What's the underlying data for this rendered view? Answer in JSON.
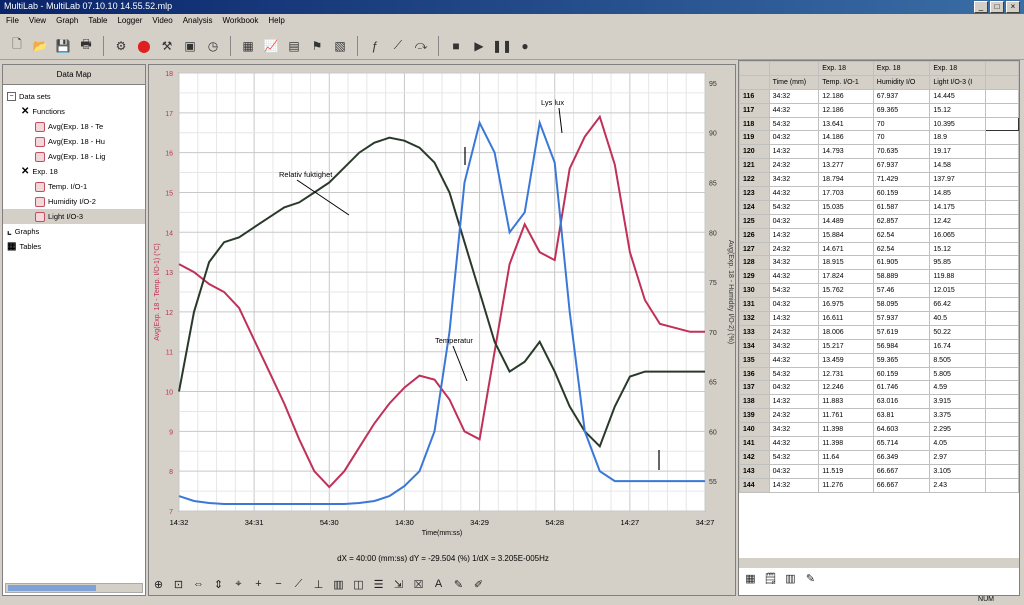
{
  "titlebar": {
    "title": "MultiLab - MultiLab 07.10.10 14.55.52.mlp",
    "buttons": [
      "_",
      "□",
      "×"
    ]
  },
  "menu": [
    "File",
    "View",
    "Graph",
    "Table",
    "Logger",
    "Video",
    "Analysis",
    "Workbook",
    "Help"
  ],
  "toolbar_icons": [
    "new-file-icon",
    "open-folder-icon",
    "save-icon",
    "print-icon",
    "run-icon",
    "stop-icon",
    "setup-icon",
    "logger-icon",
    "timer-icon",
    "graph-icon",
    "chart-icon",
    "table-icon",
    "flag-icon",
    "map-icon",
    "function-icon",
    "fit-icon",
    "curve-icon",
    "stop-square-icon",
    "play-icon",
    "pause-icon",
    "record-icon"
  ],
  "datamap": {
    "header": "Data Map",
    "tree": [
      {
        "label": "Data sets",
        "level": 0,
        "kind": "expander"
      },
      {
        "label": "Functions",
        "level": 1,
        "kind": "x"
      },
      {
        "label": "Avg(Exp. 18 - Te",
        "level": 2,
        "kind": "func"
      },
      {
        "label": "Avg(Exp. 18 - Hu",
        "level": 2,
        "kind": "func"
      },
      {
        "label": "Avg(Exp. 18 - Lig",
        "level": 2,
        "kind": "func"
      },
      {
        "label": "Exp. 18",
        "level": 1,
        "kind": "x"
      },
      {
        "label": "Temp. I/O-1",
        "level": 2,
        "kind": "sensor"
      },
      {
        "label": "Humidity I/O-2",
        "level": 2,
        "kind": "sensor"
      },
      {
        "label": "Light I/O-3",
        "level": 2,
        "kind": "sensor"
      },
      {
        "label": "Graphs",
        "level": 0,
        "kind": "graph"
      },
      {
        "label": "Tables",
        "level": 0,
        "kind": "table"
      }
    ]
  },
  "graph": {
    "status": "dX = 40:00 (mm:ss) dY = -29.504 (%)  1/dX = 3.205E-005Hz",
    "xlabel": "Time(mm:ss)",
    "left_axis_label": "Avg(Exp. 18 - Temp. I/O-1) (°C)",
    "right_axis_label": "Avg(Exp. 18 - Humidity I/O-2) (%)",
    "annotations": {
      "humidity": "Relativ fuktighet",
      "light": "Lys lux",
      "temp": "Temperatur"
    },
    "tools": [
      "zoom-in-icon",
      "zoom-box-icon",
      "zoom-x-icon",
      "zoom-y-icon",
      "cursor-icon",
      "plus-icon",
      "minus-icon",
      "line-chart-icon",
      "axis-icon",
      "bars-icon",
      "graph-type-icon",
      "legend-icon",
      "scale-icon",
      "close-graph-icon",
      "text-icon",
      "marker-icon",
      "pen-icon"
    ]
  },
  "chart_data": {
    "type": "line",
    "x_tick_labels": [
      "14:32",
      "34:31",
      "54:30",
      "14:30",
      "34:29",
      "54:28",
      "14:27",
      "34:27"
    ],
    "x": [
      0,
      10,
      20,
      30,
      40,
      50,
      60,
      70,
      80,
      90,
      100,
      110,
      120,
      130,
      140,
      150,
      160,
      170,
      180,
      190,
      200,
      210,
      220,
      230,
      240,
      250,
      260,
      270,
      280,
      290,
      300,
      310,
      320,
      330,
      340,
      350
    ],
    "ylim_left": [
      7,
      18
    ],
    "ylim_right": [
      52,
      96
    ],
    "left_ticks": [
      7,
      8,
      9,
      10,
      11,
      12,
      13,
      14,
      15,
      16,
      17,
      18
    ],
    "right_ticks": [
      55,
      60,
      65,
      70,
      75,
      80,
      85,
      90,
      95
    ],
    "series": [
      {
        "name": "Temperatur",
        "axis": "left",
        "color": "#c03058",
        "values": [
          13.2,
          13.0,
          12.7,
          12.5,
          12.1,
          11.3,
          10.5,
          9.7,
          8.8,
          8.0,
          7.6,
          8.0,
          8.6,
          9.2,
          9.7,
          10.1,
          10.4,
          10.3,
          9.8,
          9.0,
          8.8,
          11.0,
          13.2,
          14.2,
          13.5,
          13.3,
          15.6,
          16.4,
          16.9,
          15.7,
          13.5,
          12.3,
          11.7,
          11.6,
          11.5,
          11.5
        ]
      },
      {
        "name": "Relativ fuktighet",
        "axis": "right",
        "color": "#2a3a2a",
        "values": [
          64.0,
          72.0,
          77.0,
          79.0,
          79.5,
          80.5,
          81.5,
          82.5,
          83.0,
          84.0,
          85.0,
          86.5,
          88.0,
          89.0,
          89.5,
          89.2,
          88.5,
          87.0,
          84.0,
          79.0,
          74.0,
          69.0,
          66.0,
          67.0,
          69.0,
          66.0,
          62.5,
          60.0,
          58.5,
          62.5,
          65.5,
          66.0,
          66.0,
          66.0,
          66.0,
          66.0
        ]
      },
      {
        "name": "Lys lux",
        "axis": "right",
        "color": "#3a78d8",
        "values": [
          53.5,
          53.0,
          52.8,
          52.7,
          52.7,
          52.7,
          52.7,
          52.7,
          52.7,
          52.7,
          52.7,
          52.7,
          52.8,
          53.0,
          53.5,
          54.5,
          56.0,
          60.0,
          70.0,
          85.0,
          91.0,
          88.0,
          80.0,
          82.0,
          91.0,
          87.0,
          72.0,
          60.0,
          56.0,
          55.0,
          55.0,
          55.0,
          55.0,
          55.0,
          55.0,
          55.0
        ]
      }
    ]
  },
  "table": {
    "headers_top": [
      "",
      "",
      "Exp. 18",
      "Exp. 18",
      "Exp. 18"
    ],
    "headers": [
      "",
      "Time (mm)",
      "Temp. I/O-1",
      "Humidity I/O",
      "Light I/O-3 (I"
    ],
    "rows": [
      [
        "116",
        "34:32",
        "12.186",
        "67.937",
        "14.445"
      ],
      [
        "117",
        "44:32",
        "12.186",
        "69.365",
        "15.12"
      ],
      [
        "118",
        "54:32",
        "13.641",
        "70",
        "10.395"
      ],
      [
        "119",
        "04:32",
        "14.186",
        "70",
        "18.9"
      ],
      [
        "120",
        "14:32",
        "14.793",
        "70.635",
        "19.17"
      ],
      [
        "121",
        "24:32",
        "13.277",
        "67.937",
        "14.58"
      ],
      [
        "122",
        "34:32",
        "18.794",
        "71.429",
        "137.97"
      ],
      [
        "123",
        "44:32",
        "17.703",
        "60.159",
        "14.85"
      ],
      [
        "124",
        "54:32",
        "15.035",
        "61.587",
        "14.175"
      ],
      [
        "125",
        "04:32",
        "14.489",
        "62.857",
        "12.42"
      ],
      [
        "126",
        "14:32",
        "15.884",
        "62.54",
        "16.065"
      ],
      [
        "127",
        "24:32",
        "14.671",
        "62.54",
        "15.12"
      ],
      [
        "128",
        "34:32",
        "18.915",
        "61.905",
        "95.85"
      ],
      [
        "129",
        "44:32",
        "17.824",
        "58.889",
        "119.88"
      ],
      [
        "130",
        "54:32",
        "15.762",
        "57.46",
        "12.015"
      ],
      [
        "131",
        "04:32",
        "16.975",
        "58.095",
        "66.42"
      ],
      [
        "132",
        "14:32",
        "16.611",
        "57.937",
        "40.5"
      ],
      [
        "133",
        "24:32",
        "18.006",
        "57.619",
        "50.22"
      ],
      [
        "134",
        "34:32",
        "15.217",
        "56.984",
        "16.74"
      ],
      [
        "135",
        "44:32",
        "13.459",
        "59.365",
        "8.505"
      ],
      [
        "136",
        "54:32",
        "12.731",
        "60.159",
        "5.805"
      ],
      [
        "137",
        "04:32",
        "12.246",
        "61.746",
        "4.59"
      ],
      [
        "138",
        "14:32",
        "11.883",
        "63.016",
        "3.915"
      ],
      [
        "139",
        "24:32",
        "11.761",
        "63.81",
        "3.375"
      ],
      [
        "140",
        "34:32",
        "11.398",
        "64.603",
        "2.295"
      ],
      [
        "141",
        "44:32",
        "11.398",
        "65.714",
        "4.05"
      ],
      [
        "142",
        "54:32",
        "11.64",
        "66.349",
        "2.97"
      ],
      [
        "143",
        "04:32",
        "11.519",
        "66.667",
        "3.105"
      ],
      [
        "144",
        "14:32",
        "11.276",
        "66.667",
        "2.43"
      ]
    ],
    "tools": [
      "table-grid-icon",
      "properties-icon",
      "columns-icon",
      "edit-icon"
    ]
  },
  "statusbar": {
    "num": "NUM"
  }
}
